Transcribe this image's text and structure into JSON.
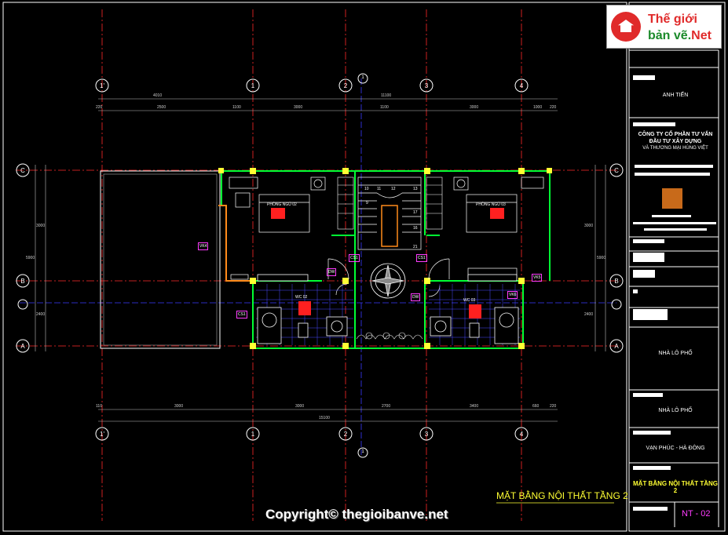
{
  "logo": {
    "line1": "Thế giới",
    "line2": "bản vẽ.",
    "line2_accent": "Net"
  },
  "title_block": {
    "owner": "ANH TIẾN",
    "company": [
      "CÔNG TY CỔ PHẦN TƯ VẤN",
      "ĐẦU TƯ XÂY DỰNG",
      "VÀ THƯƠNG MẠI HÙNG VIỆT"
    ],
    "project1": "NHÀ LÔ PHỐ",
    "project2": "NHÀ LÔ PHỐ",
    "location": "VẠN PHÚC - HÀ ĐÔNG",
    "drawing_name": "MẶT BẰNG NỘI THẤT TẦNG 2",
    "sheet": "NT - 02"
  },
  "drawing": {
    "title": "MẶT BẰNG NỘI THẤT TẦNG 2",
    "grid_cols": [
      "1'",
      "1",
      "2",
      "3",
      "4"
    ],
    "grid_rows": [
      "C",
      "B",
      "A"
    ],
    "dims_top_total": "11100",
    "dims_top_sub": [
      "220",
      "4010",
      "2500",
      "1100",
      "3000",
      "1100",
      "3000",
      "1000",
      "220"
    ],
    "dims_bottom_total": "15100",
    "dims_bottom_sub": [
      "110",
      "3000",
      "3000",
      "2700",
      "3400",
      "660",
      "220"
    ],
    "dims_left": [
      "3000",
      "2400",
      "5900"
    ],
    "dims_right": [
      "3000",
      "2400",
      "5900"
    ],
    "rooms": [
      {
        "key": "bed1",
        "label": "PHÒNG NGỦ 02"
      },
      {
        "key": "bed2",
        "label": "PHÒNG NGỦ 03"
      },
      {
        "key": "wc1",
        "label": "WC 02"
      },
      {
        "key": "wc2",
        "label": "WC 03"
      }
    ],
    "tags": [
      "VK4",
      "CS1",
      "CS1",
      "DW",
      "DW",
      "VK5",
      "VK6",
      "CS1"
    ],
    "stair_steps": [
      "10",
      "11",
      "12",
      "9",
      "13",
      "17",
      "16",
      "21"
    ],
    "section_marks": [
      "1",
      "1"
    ]
  },
  "copyright": "Copyright© thegioibanve.net",
  "colors": {
    "background": "#000000",
    "grid": "#ff2a2a",
    "wall": "#00ff33",
    "column": "#ffff00",
    "tag": "#ff3cff",
    "axis_blue": "#3a3aff",
    "title_yellow": "#ffff00"
  }
}
